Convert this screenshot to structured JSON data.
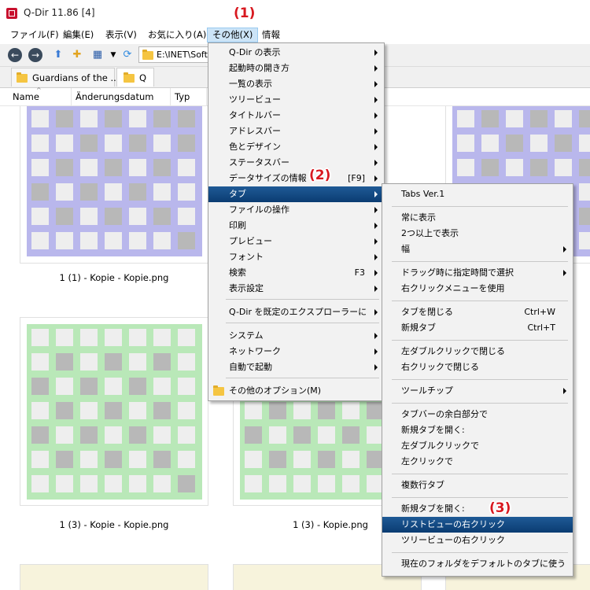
{
  "window": {
    "title": "Q-Dir 11.86 [4]"
  },
  "menubar": {
    "items": [
      {
        "label": "ファイル(F)"
      },
      {
        "label": "編集(E)"
      },
      {
        "label": "表示(V)"
      },
      {
        "label": "お気に入り(A)"
      },
      {
        "label": "その他(X)"
      },
      {
        "label": "情報"
      }
    ]
  },
  "toolbar": {
    "address": "E:\\INET\\Soft",
    "view_icon": "view-grid-icon"
  },
  "tabs": [
    {
      "label": "Guardians of the ..."
    },
    {
      "label": "Q"
    }
  ],
  "columns": [
    "Name",
    "Änderungsdatum",
    "Typ"
  ],
  "thumbnails": [
    {
      "label": "1 (1) - Kopie - Kopie.png",
      "color": "#b9b7ec"
    },
    {
      "label": "1 (3) - Kopie - Kopie.png",
      "color": "#b9e8b8"
    },
    {
      "label": "1 (3) - Kopie.png",
      "color": "#b9e8b8"
    }
  ],
  "menu_main": {
    "items": [
      {
        "label": "Q-Dir の表示",
        "shortcut": "",
        "submenu": true
      },
      {
        "label": "起動時の開き方",
        "shortcut": "",
        "submenu": true
      },
      {
        "label": "一覧の表示",
        "shortcut": "",
        "submenu": true
      },
      {
        "label": "ツリービュー",
        "shortcut": "",
        "submenu": true
      },
      {
        "label": "タイトルバー",
        "shortcut": "",
        "submenu": true
      },
      {
        "label": "アドレスバー",
        "shortcut": "",
        "submenu": true
      },
      {
        "label": "色とデザイン",
        "shortcut": "",
        "submenu": true
      },
      {
        "label": "ステータスバー",
        "shortcut": "",
        "submenu": true
      },
      {
        "label": "データサイズの情報",
        "shortcut": "[F9]",
        "submenu": true
      },
      {
        "label": "タブ",
        "shortcut": "",
        "submenu": true,
        "highlighted": true
      },
      {
        "label": "ファイルの操作",
        "shortcut": "",
        "submenu": true
      },
      {
        "label": "印刷",
        "shortcut": "",
        "submenu": true
      },
      {
        "label": "プレビュー",
        "shortcut": "",
        "submenu": true
      },
      {
        "label": "フォント",
        "shortcut": "",
        "submenu": true
      },
      {
        "label": "検索",
        "shortcut": "F3",
        "submenu": true
      },
      {
        "label": "表示設定",
        "shortcut": "",
        "submenu": true
      },
      {
        "label": "Q-Dir を既定のエクスプローラーに",
        "shortcut": "",
        "submenu": true
      },
      {
        "label": "システム",
        "shortcut": "",
        "submenu": true
      },
      {
        "label": "ネットワーク",
        "shortcut": "",
        "submenu": true
      },
      {
        "label": "自動で起動",
        "shortcut": "",
        "submenu": true
      },
      {
        "label": "その他のオプション(M)",
        "shortcut": "",
        "submenu": false
      }
    ]
  },
  "menu_tabs": {
    "items": [
      {
        "label": "Tabs Ver.1",
        "shortcut": "",
        "submenu": false
      },
      {
        "label": "常に表示",
        "shortcut": "",
        "submenu": false
      },
      {
        "label": "2つ以上で表示",
        "shortcut": "",
        "submenu": false
      },
      {
        "label": "幅",
        "shortcut": "",
        "submenu": true
      },
      {
        "label": "ドラッグ時に指定時間で選択",
        "shortcut": "",
        "submenu": true
      },
      {
        "label": "右クリックメニューを使用",
        "shortcut": "",
        "submenu": false
      },
      {
        "label": "タブを閉じる",
        "shortcut": "Ctrl+W",
        "submenu": false
      },
      {
        "label": "新規タブ",
        "shortcut": "Ctrl+T",
        "submenu": false
      },
      {
        "label": "左ダブルクリックで閉じる",
        "shortcut": "",
        "submenu": false
      },
      {
        "label": "右クリックで閉じる",
        "shortcut": "",
        "submenu": false
      },
      {
        "label": "ツールチップ",
        "shortcut": "",
        "submenu": true
      },
      {
        "label": "タブバーの余白部分で",
        "shortcut": "",
        "submenu": false
      },
      {
        "label": "新規タブを開く:",
        "shortcut": "",
        "submenu": false
      },
      {
        "label": "左ダブルクリックで",
        "shortcut": "",
        "submenu": false
      },
      {
        "label": "左クリックで",
        "shortcut": "",
        "submenu": false
      },
      {
        "label": "複数行タブ",
        "shortcut": "",
        "submenu": false
      },
      {
        "label": "新規タブを開く:",
        "shortcut": "",
        "submenu": false
      },
      {
        "label": "リストビューの右クリック",
        "shortcut": "",
        "submenu": false,
        "highlighted": true
      },
      {
        "label": "ツリービューの右クリック",
        "shortcut": "",
        "submenu": false
      },
      {
        "label": "現在のフォルダをデフォルトのタブに使う",
        "shortcut": "",
        "submenu": false
      }
    ]
  },
  "annotations": [
    "(1)",
    "(2)",
    "(3)"
  ],
  "colors": {
    "highlight": "#0b3c72",
    "annotation": "#d8181f",
    "menu_bg": "#f2f2f2"
  }
}
